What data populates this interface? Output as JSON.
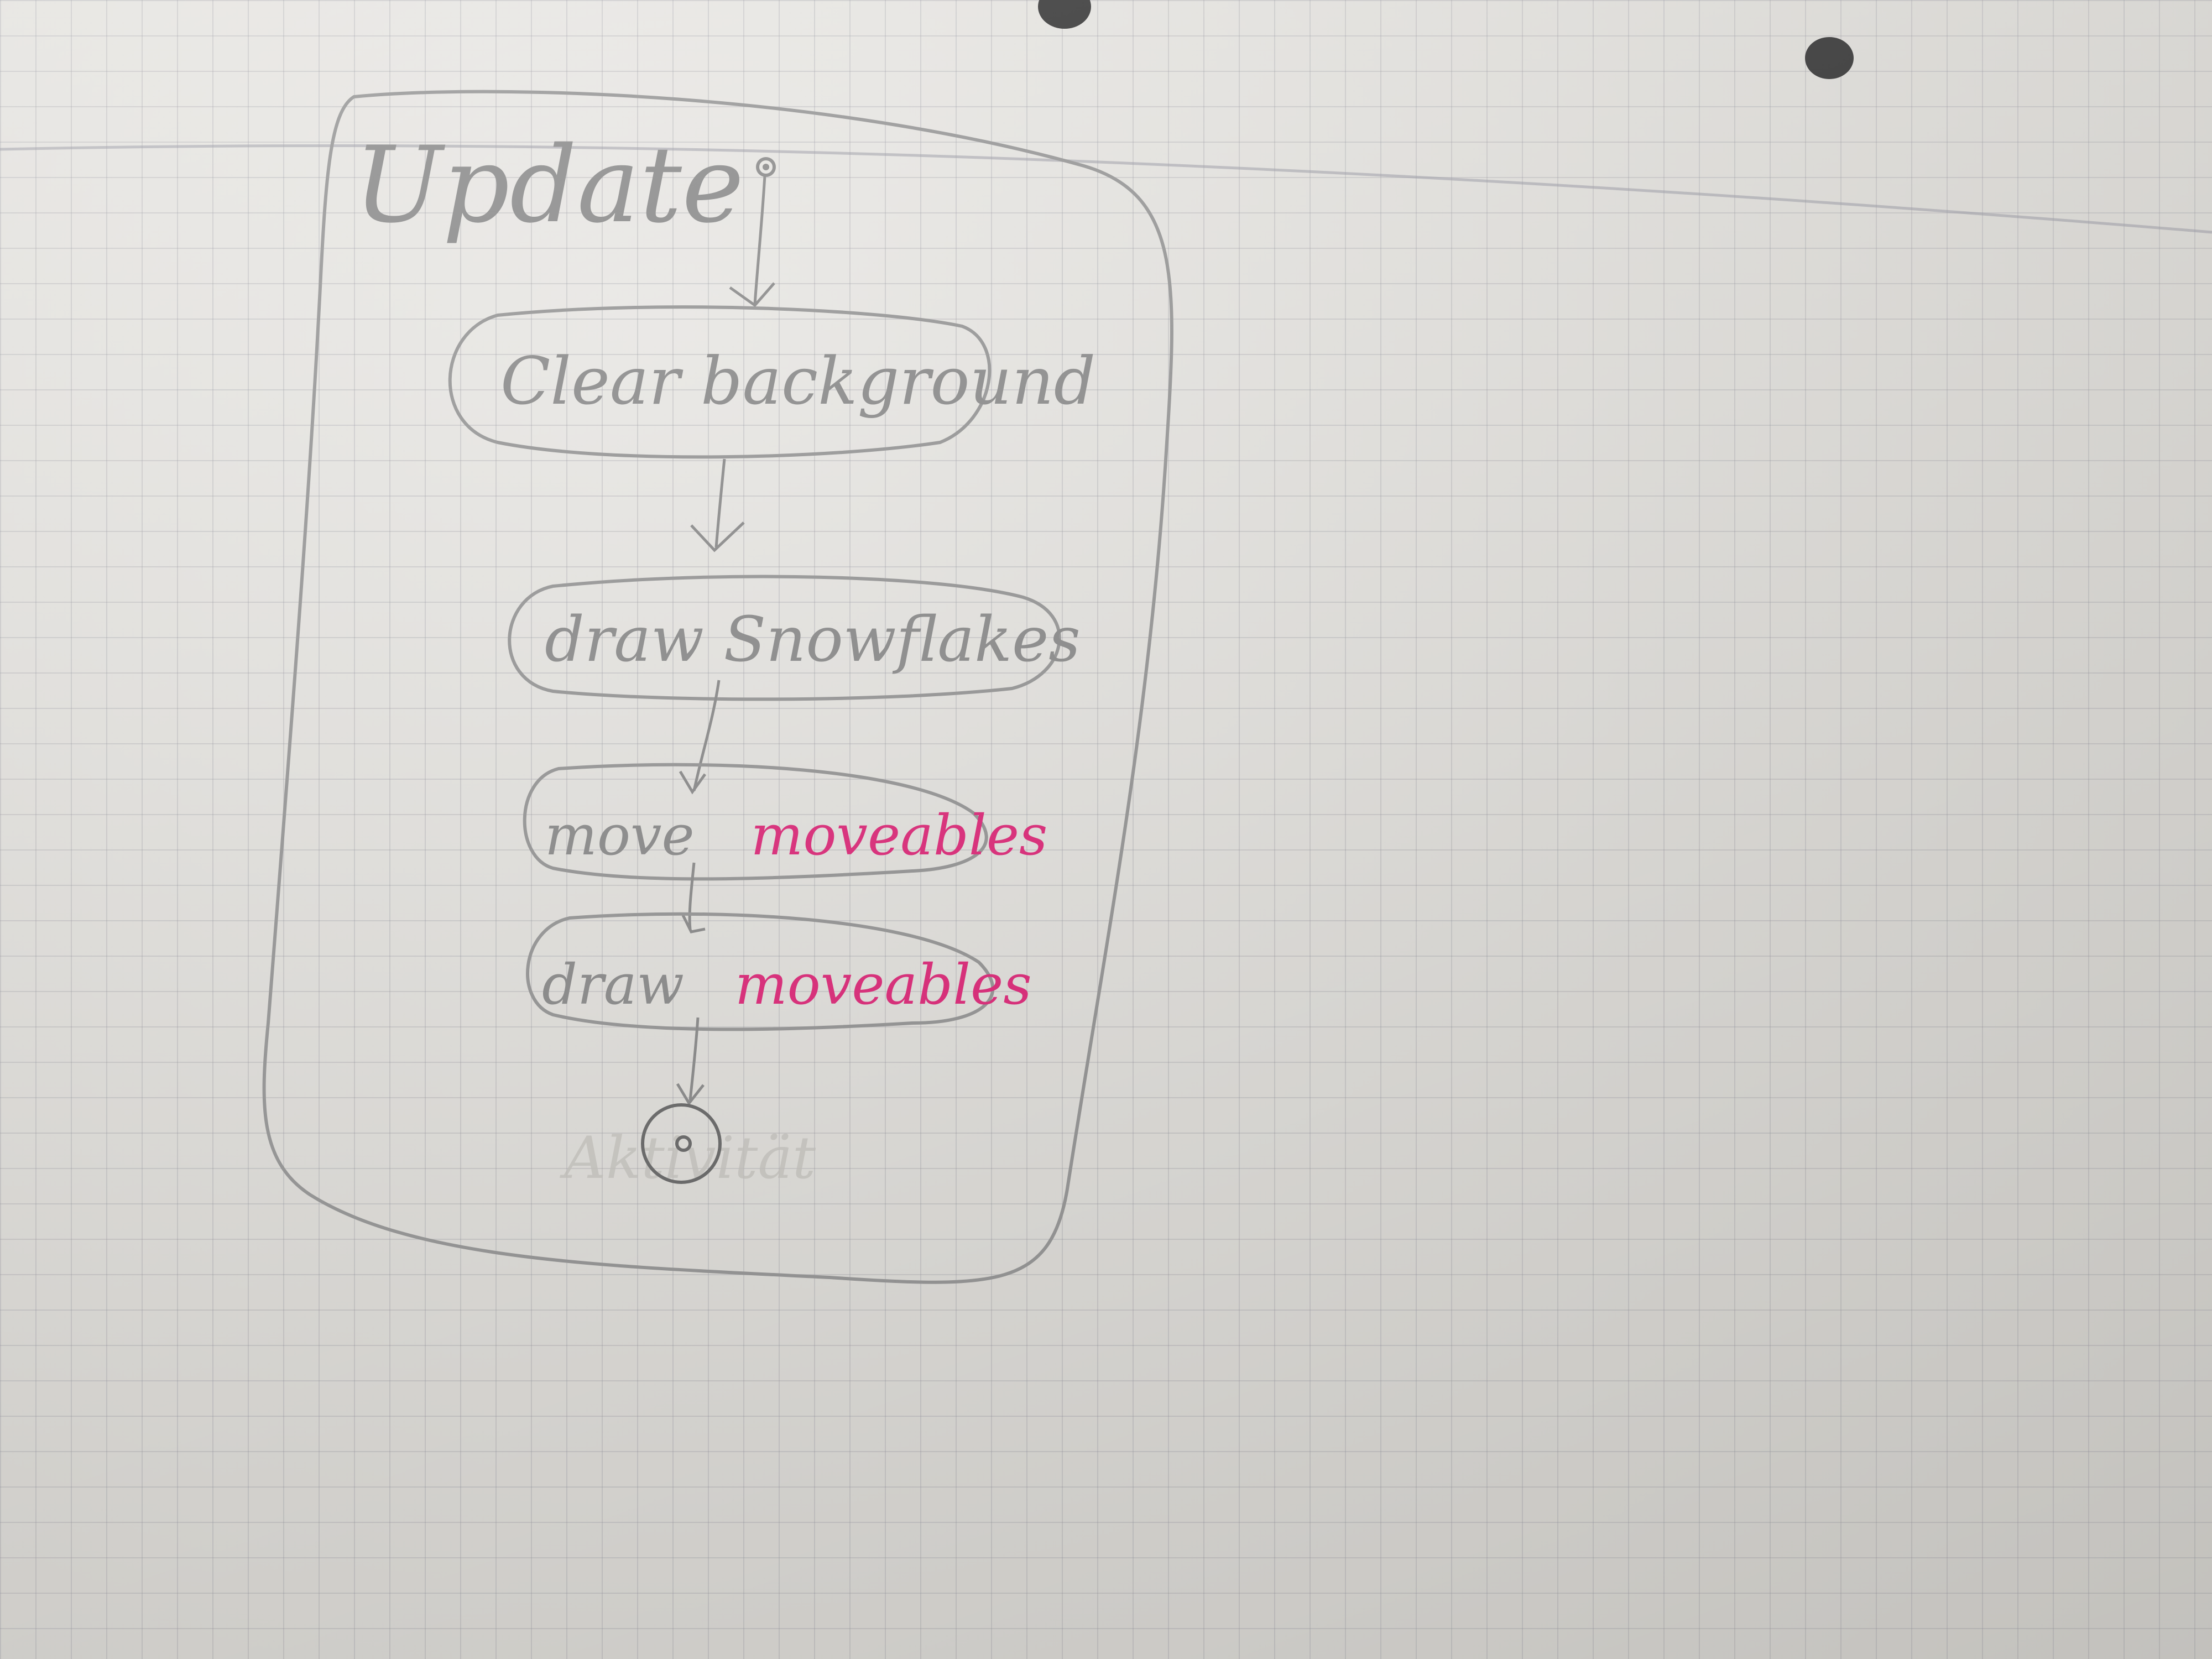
{
  "diagram": {
    "title": "Update",
    "nodes": [
      {
        "id": "clear",
        "label": "Clear background"
      },
      {
        "id": "snow",
        "label": "draw Snowflakes"
      },
      {
        "id": "move",
        "label_main": "move",
        "label_accent": "moveables"
      },
      {
        "id": "draw",
        "label_main": "draw",
        "label_accent": "moveables"
      }
    ],
    "faded_text": "Aktivität",
    "colors": {
      "pencil": "#8f8f8f",
      "pink": "#e0307e",
      "paper": "#e3e1dc",
      "grid": "#a0a0aa"
    }
  }
}
